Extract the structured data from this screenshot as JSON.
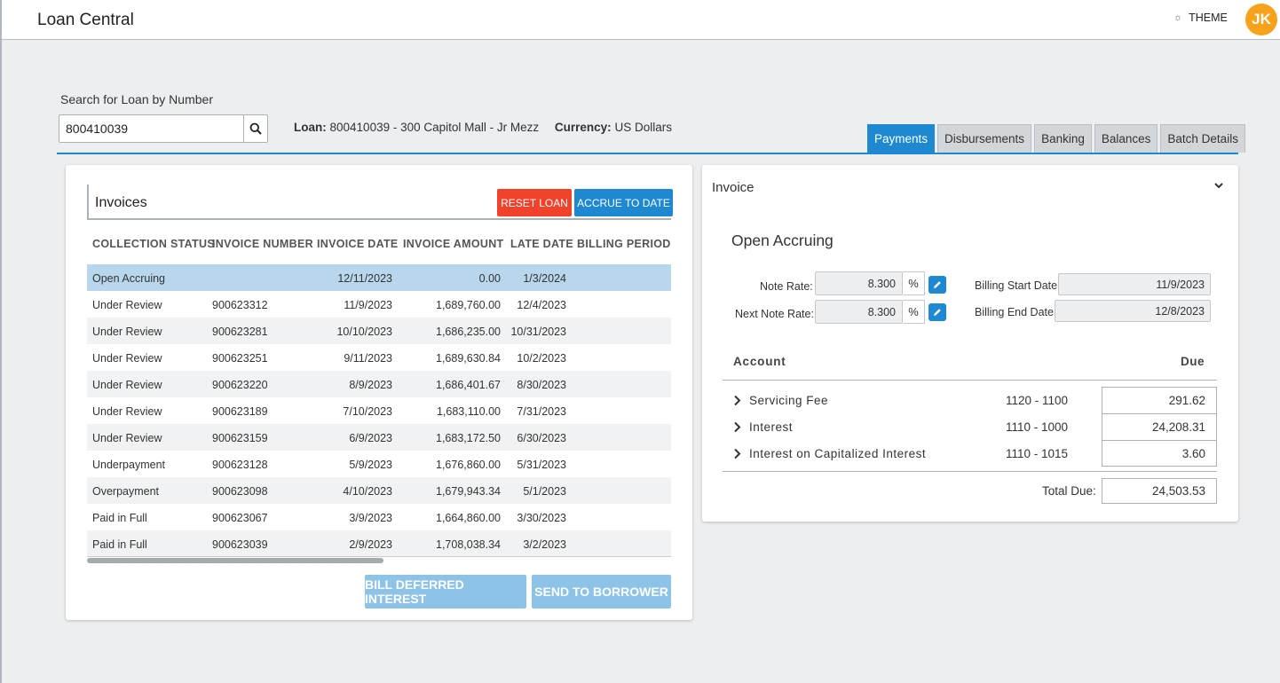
{
  "header": {
    "app_title": "Loan Central",
    "theme_label": "THEME",
    "avatar_initials": "JK",
    "avatar_color": "#f7a21b"
  },
  "search": {
    "label": "Search for Loan by Number",
    "value": "800410039"
  },
  "loan_info": {
    "loan_label": "Loan:",
    "loan_value": "800410039 - 300 Capitol Mall - Jr Mezz",
    "currency_label": "Currency:",
    "currency_value": "US Dollars"
  },
  "tabs": [
    "Payments",
    "Disbursements",
    "Banking",
    "Balances",
    "Batch Details"
  ],
  "invoices": {
    "title": "Invoices",
    "reset_label": "RESET LOAN",
    "accrue_label": "ACCRUE TO DATE",
    "columns": [
      "COLLECTION STATUS",
      "INVOICE NUMBER",
      "INVOICE DATE",
      "INVOICE AMOUNT",
      "LATE DATE",
      "BILLING PERIOD S"
    ],
    "rows": [
      [
        "Open Accruing",
        "",
        "12/11/2023",
        "0.00",
        "1/3/2024"
      ],
      [
        "Under Review",
        "900623312",
        "11/9/2023",
        "1,689,760.00",
        "12/4/2023"
      ],
      [
        "Under Review",
        "900623281",
        "10/10/2023",
        "1,686,235.00",
        "10/31/2023"
      ],
      [
        "Under Review",
        "900623251",
        "9/11/2023",
        "1,689,630.84",
        "10/2/2023"
      ],
      [
        "Under Review",
        "900623220",
        "8/9/2023",
        "1,686,401.67",
        "8/30/2023"
      ],
      [
        "Under Review",
        "900623189",
        "7/10/2023",
        "1,683,110.00",
        "7/31/2023"
      ],
      [
        "Under Review",
        "900623159",
        "6/9/2023",
        "1,683,172.50",
        "6/30/2023"
      ],
      [
        "Underpayment",
        "900623128",
        "5/9/2023",
        "1,676,860.00",
        "5/31/2023"
      ],
      [
        "Overpayment",
        "900623098",
        "4/10/2023",
        "1,679,943.34",
        "5/1/2023"
      ],
      [
        "Paid in Full",
        "900623067",
        "3/9/2023",
        "1,664,860.00",
        "3/30/2023"
      ],
      [
        "Paid in Full",
        "900623039",
        "2/9/2023",
        "1,708,038.34",
        "3/2/2023"
      ]
    ],
    "bill_label": "BILL DEFERRED INTEREST",
    "send_label": "SEND TO BORROWER"
  },
  "invoice_panel": {
    "title": "Invoice",
    "status": "Open Accruing",
    "note_rate_label": "Note Rate:",
    "note_rate": "8.300",
    "next_note_rate_label": "Next Note Rate:",
    "next_note_rate": "8.300",
    "pct_symbol": "%",
    "billing_start_label": "Billing Start Date",
    "billing_start": "11/9/2023",
    "billing_end_label": "Billing End Date",
    "billing_end": "12/8/2023",
    "account_header": "Account",
    "due_header": "Due",
    "accounts": [
      {
        "name": "Servicing Fee",
        "code": "1120 - 1100",
        "due": "291.62"
      },
      {
        "name": "Interest",
        "code": "1110 - 1000",
        "due": "24,208.31"
      },
      {
        "name": "Interest on Capitalized Interest",
        "code": "1110 - 1015",
        "due": "3.60"
      }
    ],
    "total_label": "Total Due:",
    "total_value": "24,503.53"
  },
  "colors": {
    "primary": "#1e88d0",
    "danger": "#f1432b",
    "selected_row": "#b8d7ec",
    "disabled_button": "#8ec3e8"
  }
}
